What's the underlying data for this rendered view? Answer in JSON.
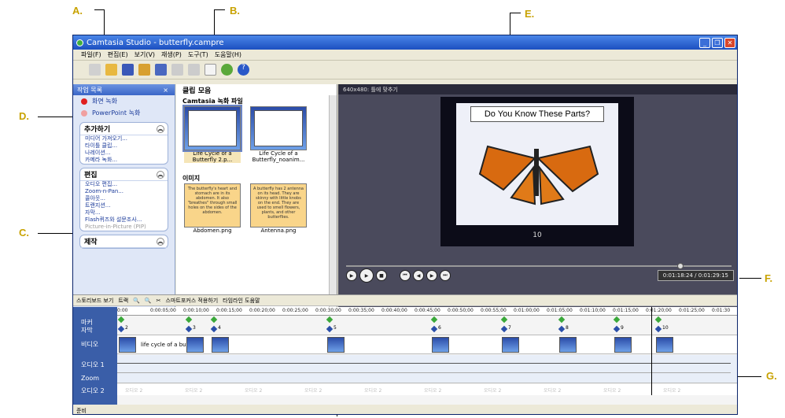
{
  "callouts": {
    "a": "A.",
    "b": "B.",
    "c": "C.",
    "d": "D.",
    "e": "E.",
    "f": "F.",
    "g": "G."
  },
  "window": {
    "title": "Camtasia Studio - butterfly.campre"
  },
  "menu": [
    "파일(F)",
    "편집(E)",
    "보기(V)",
    "재생(P)",
    "도구(T)",
    "도움말(H)"
  ],
  "task_pane": {
    "title": "작업 목록",
    "close": "×",
    "record_screen": "화면 녹화",
    "record_ppt": "PowerPoint 녹화",
    "groups": [
      {
        "title": "추가하기",
        "items": [
          "미디어 가져오기...",
          "타이틀 클립...",
          "나레이션...",
          "카메라 녹화..."
        ]
      },
      {
        "title": "편집",
        "items": [
          "오디오 편집...",
          "Zoom-n-Pan...",
          "콜아웃...",
          "트랜지션...",
          "자막...",
          "Flash퀴즈와 설문조사...",
          "Picture-in-Picture (PIP)"
        ]
      },
      {
        "title": "제작",
        "items": []
      }
    ]
  },
  "clip_bin": {
    "title": "클립 모음",
    "section_rec": "Camtasia 녹화 파일",
    "section_img": "이미지",
    "clips": [
      {
        "label": "Life Cycle of a Butterfly 2.p..."
      },
      {
        "label": "Life Cycle of a Butterfly_noanim..."
      }
    ],
    "images": [
      {
        "label": "Abdomen.png",
        "text": "The butterfly's heart and stomach are in its abdomen. It also \"breathes\" through small holes on the sides of the abdomen."
      },
      {
        "label": "Antenna.png",
        "text": "A butterfly has 2 antenna on its head. They are skinny with little knobs on the end. They are used to smell flowers, plants, and other butterflies."
      }
    ]
  },
  "preview": {
    "size_label": "640x480: 틀에 맞추기",
    "slide_title": "Do You Know These Parts?",
    "slide_number": "10",
    "timecode": "0:01:18:24 / 0:01:29:15",
    "playhead_fraction": 0.86
  },
  "timeline_toolbar": {
    "storyboard": "스토리보드 보기",
    "tracks": "트랙",
    "smart_focus": "스마트포커스 적용하기",
    "help": "타임라인 도움말"
  },
  "tracks": {
    "marker": "마커",
    "caption": "자막",
    "video": "비디오",
    "audio1": "오디오 1",
    "zoom": "Zoom",
    "audio2": "오디오 2"
  },
  "ruler_ticks": [
    "0:00",
    "0:00:05;00",
    "0:00:10;00",
    "0:00:15;00",
    "0:00:20;00",
    "0:00:25;00",
    "0:00:30;00",
    "0:00:35;00",
    "0:00:40;00",
    "0:00:45;00",
    "0:00:50;00",
    "0:00:55;00",
    "0:01:00;00",
    "0:01:05;00",
    "0:01:10;00",
    "0:01:15;00",
    "0:01:20;00",
    "0:01:25;00",
    "0:01:30"
  ],
  "captions": [
    "2",
    "3",
    "4",
    "5",
    "6",
    "7",
    "8",
    "9",
    "10"
  ],
  "video_clip_label": "life cycle of a butt",
  "audio2_text": "오디오 2",
  "status": "준비"
}
